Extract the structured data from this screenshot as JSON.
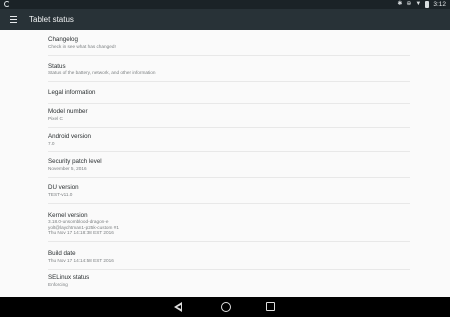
{
  "status_bar": {
    "left_icon": "sync-icon",
    "icons": [
      "bluetooth-icon",
      "data-saver-icon",
      "wifi-icon",
      "battery-icon"
    ],
    "time": "3:12"
  },
  "app_bar": {
    "menu_icon": "hamburger-menu-icon",
    "title": "Tablet status"
  },
  "items": [
    {
      "title": "Changelog",
      "subtitle": "Check in see what has changed!"
    },
    {
      "title": "Status",
      "subtitle": "Status of the battery, network, and other information"
    },
    {
      "title": "Legal information",
      "subtitle": ""
    },
    {
      "title": "Model number",
      "subtitle": "Pixel C"
    },
    {
      "title": "Android version",
      "subtitle": "7.0"
    },
    {
      "title": "Security patch level",
      "subtitle": "November 5, 2016"
    },
    {
      "title": "DU version",
      "subtitle": "TEST-v11.0"
    },
    {
      "title": "Kernel version",
      "subtitle_lines": [
        "3.18.0-unsomblood-dragon-e",
        "yolt@laychtman1-p25k-custom #1",
        "Thu Nov 17 14:18:38 EST 2016"
      ]
    },
    {
      "title": "Build date",
      "subtitle": "Thu Nov 17 14:14:58 EST 2016"
    },
    {
      "title": "SELinux status",
      "subtitle": "Enforcing"
    }
  ],
  "nav_bar": {
    "back": "back-icon",
    "home": "home-icon",
    "recents": "recents-icon"
  }
}
